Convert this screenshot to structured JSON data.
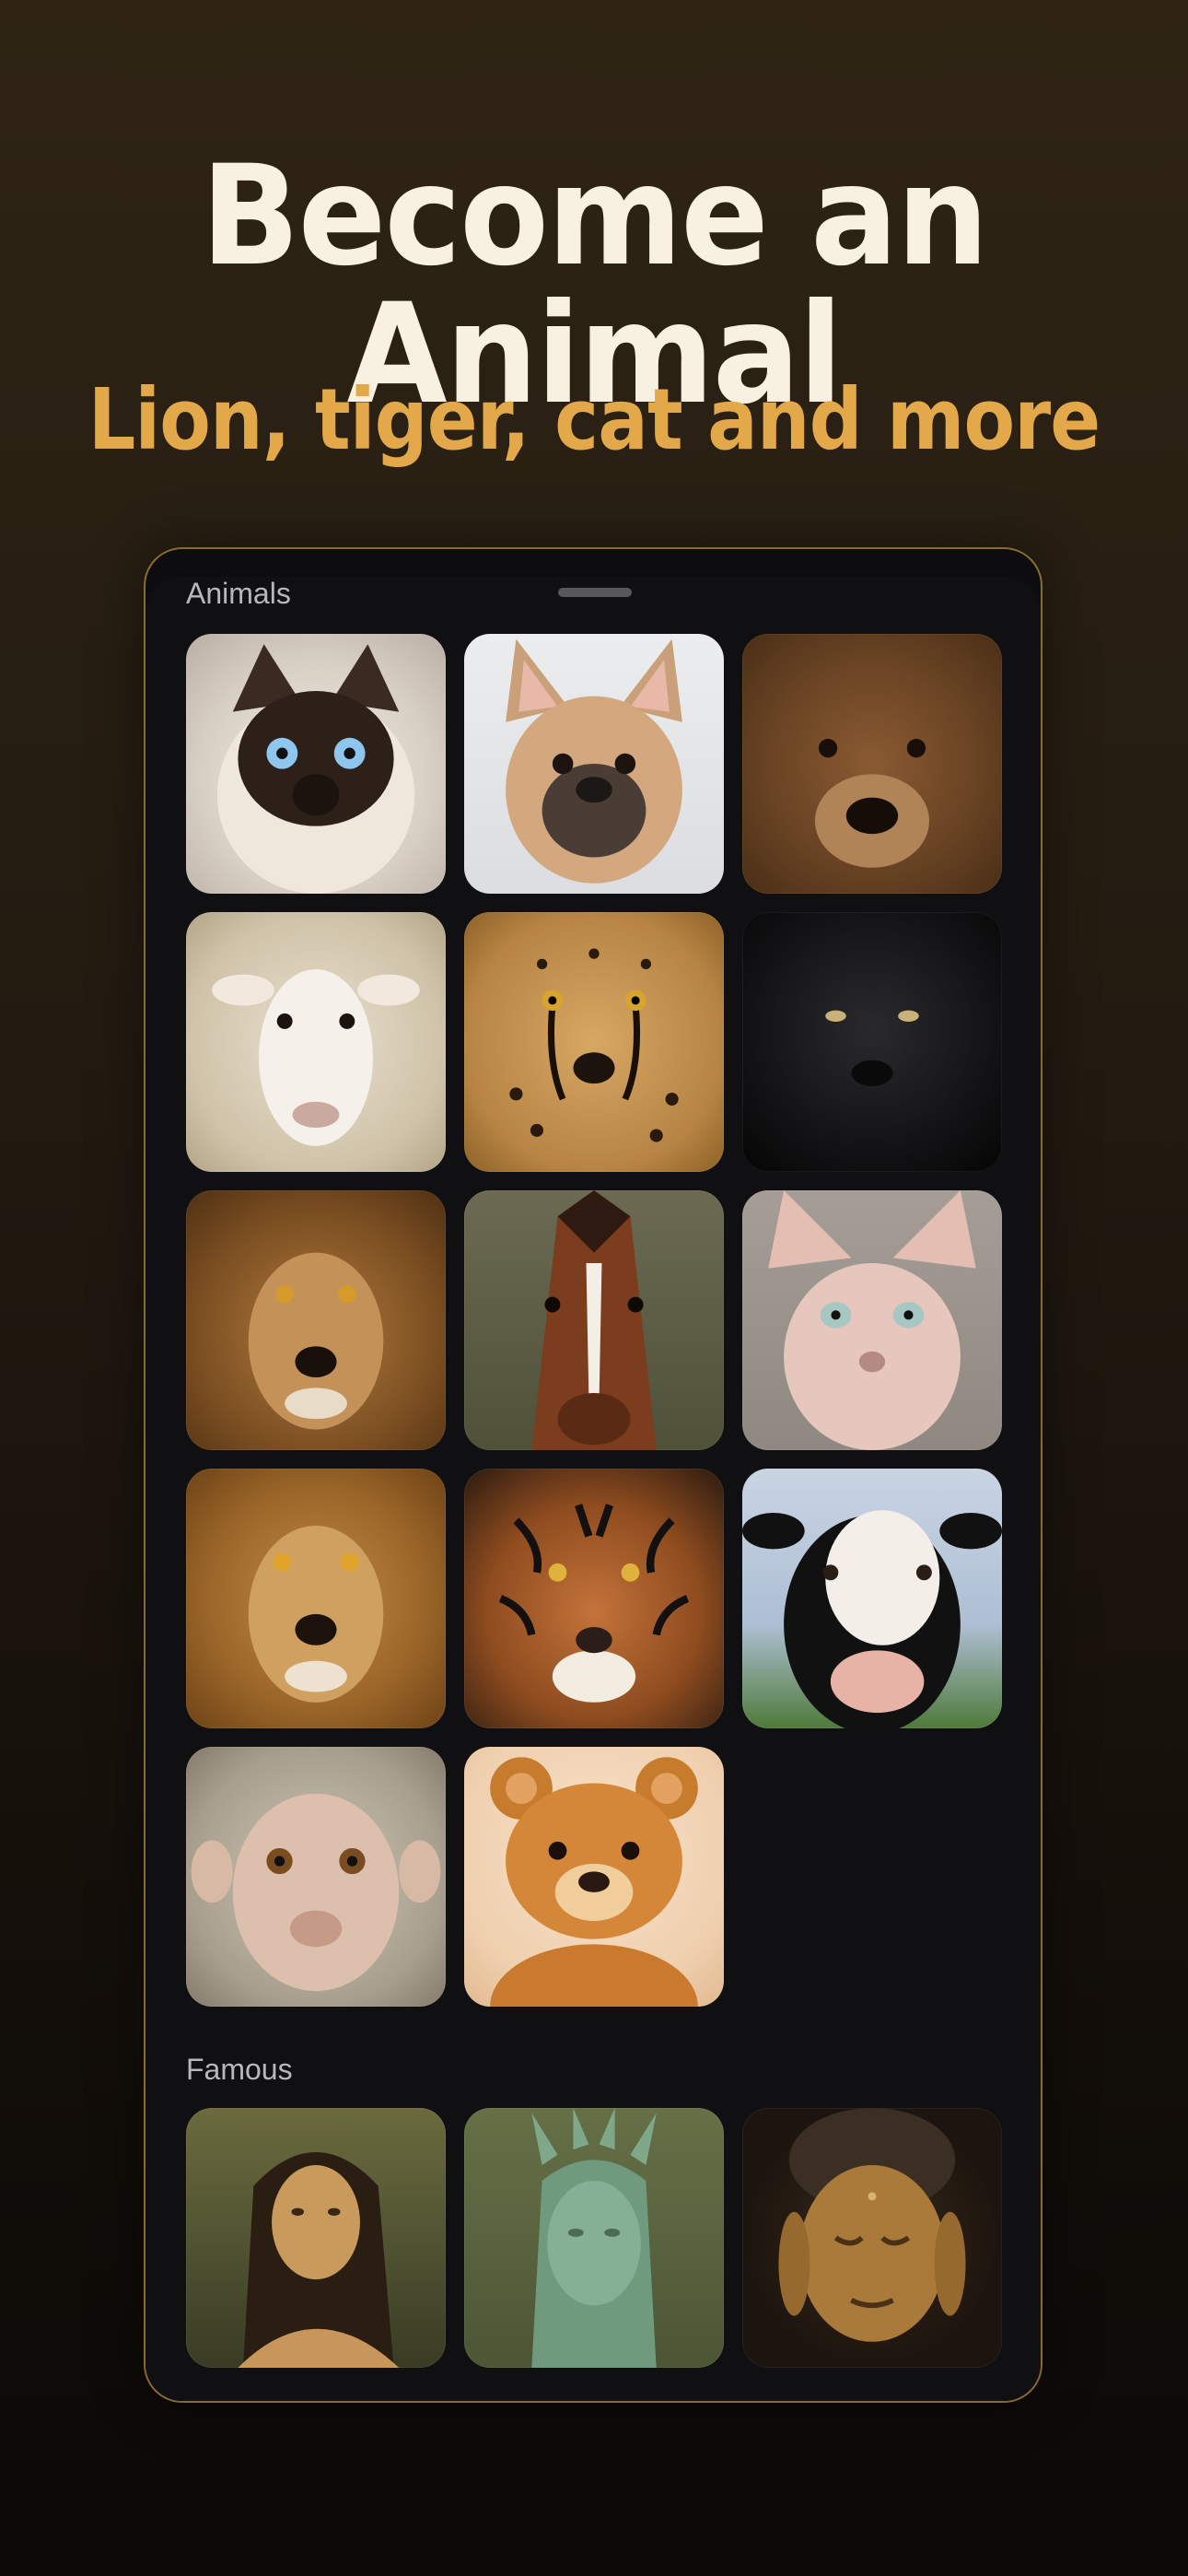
{
  "headline": "Become an Animal",
  "subheadline": "Lion, tiger, cat and more",
  "sheet": {
    "sections": [
      {
        "label": "Animals",
        "items": [
          {
            "icon": "siamese-cat-icon"
          },
          {
            "icon": "french-bulldog-icon"
          },
          {
            "icon": "bear-icon"
          },
          {
            "icon": "sheep-icon"
          },
          {
            "icon": "cheetah-icon"
          },
          {
            "icon": "black-panther-icon"
          },
          {
            "icon": "lion-icon"
          },
          {
            "icon": "horse-icon"
          },
          {
            "icon": "sphynx-cat-icon"
          },
          {
            "icon": "lion-icon"
          },
          {
            "icon": "tiger-icon"
          },
          {
            "icon": "cow-icon"
          },
          {
            "icon": "monkey-icon"
          },
          {
            "icon": "teddy-bear-icon"
          }
        ]
      },
      {
        "label": "Famous",
        "items": [
          {
            "icon": "mona-lisa-icon"
          },
          {
            "icon": "statue-of-liberty-icon"
          },
          {
            "icon": "buddha-icon"
          }
        ]
      }
    ]
  },
  "colors": {
    "headline": "#f8f1e2",
    "accent": "#e2a84a",
    "sheet_border": "#8a6a32",
    "sheet_background": "#101013"
  }
}
